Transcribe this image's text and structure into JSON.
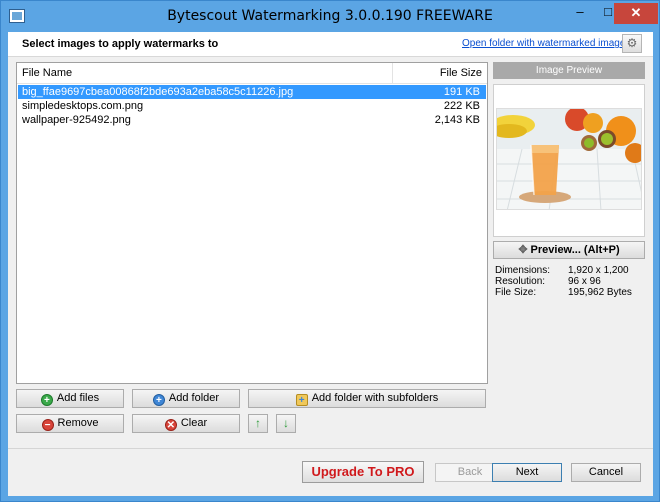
{
  "window": {
    "title": "Bytescout Watermarking 3.0.0.190 FREEWARE",
    "minimize": "–",
    "maximize": "□",
    "close": "✕"
  },
  "header": {
    "title": "Select images to apply watermarks to",
    "open_folder_link": "Open folder with watermarked images",
    "settings_icon": "gear-icon",
    "settings_glyph": "⚙"
  },
  "file_list": {
    "columns": {
      "name": "File Name",
      "size": "File Size"
    },
    "rows": [
      {
        "name": "big_ffae9697cbea00868f2bde693a2eba58c5c11226.jpg",
        "size": "191 KB",
        "selected": true
      },
      {
        "name": "simpledesktops.com.png",
        "size": "222 KB",
        "selected": false
      },
      {
        "name": "wallpaper-925492.png",
        "size": "2,143 KB",
        "selected": false
      }
    ]
  },
  "buttons": {
    "add_files": "Add files",
    "add_folder": "Add folder",
    "add_folder_subfolders": "Add folder with subfolders",
    "remove": "Remove",
    "clear": "Clear",
    "move_up": "↑",
    "move_down": "↓",
    "plus_glyph": "+",
    "minus_glyph": "−",
    "clear_glyph": "✕"
  },
  "preview": {
    "header": "Image Preview",
    "button": "Preview... (Alt+P)",
    "move_glyph": "✥",
    "info": {
      "dimensions_label": "Dimensions:",
      "dimensions_value": "1,920 x 1,200",
      "resolution_label": "Resolution:",
      "resolution_value": "96 x 96",
      "filesize_label": "File Size:",
      "filesize_value": "195,962 Bytes"
    }
  },
  "footer": {
    "upgrade": "Upgrade To PRO",
    "back": "Back",
    "next": "Next",
    "cancel": "Cancel"
  },
  "colors": {
    "titlebar": "#5ba5e4",
    "selection": "#3399ff",
    "link": "#0a4fd0",
    "upgrade_text": "#d0191c",
    "close_button": "#c7463c"
  }
}
